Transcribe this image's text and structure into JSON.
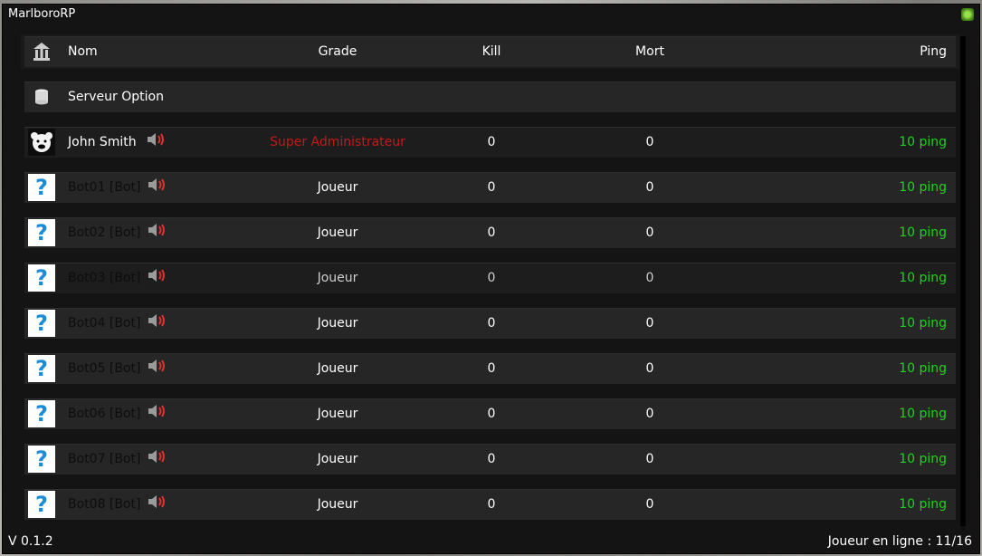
{
  "window": {
    "title": "MarlboroRP"
  },
  "header": {
    "name": "Nom",
    "grade": "Grade",
    "kill": "Kill",
    "mort": "Mort",
    "ping": "Ping"
  },
  "server_option": {
    "label": "Serveur Option"
  },
  "players": [
    {
      "name": "John Smith",
      "grade": "Super Administrateur",
      "kill": "0",
      "mort": "0",
      "ping": "10 ping",
      "avatar": "bear-avatar"
    },
    {
      "name": "Bot01 [Bot]",
      "grade": "Joueur",
      "kill": "0",
      "mort": "0",
      "ping": "10 ping",
      "avatar": "question-mark-icon"
    },
    {
      "name": "Bot02 [Bot]",
      "grade": "Joueur",
      "kill": "0",
      "mort": "0",
      "ping": "10 ping",
      "avatar": "question-mark-icon"
    },
    {
      "name": "Bot03 [Bot]",
      "grade": "Joueur",
      "kill": "0",
      "mort": "0",
      "ping": "10 ping",
      "avatar": "question-mark-icon"
    },
    {
      "name": "Bot04 [Bot]",
      "grade": "Joueur",
      "kill": "0",
      "mort": "0",
      "ping": "10 ping",
      "avatar": "question-mark-icon"
    },
    {
      "name": "Bot05 [Bot]",
      "grade": "Joueur",
      "kill": "0",
      "mort": "0",
      "ping": "10 ping",
      "avatar": "question-mark-icon"
    },
    {
      "name": "Bot06 [Bot]",
      "grade": "Joueur",
      "kill": "0",
      "mort": "0",
      "ping": "10 ping",
      "avatar": "question-mark-icon"
    },
    {
      "name": "Bot07 [Bot]",
      "grade": "Joueur",
      "kill": "0",
      "mort": "0",
      "ping": "10 ping",
      "avatar": "question-mark-icon"
    },
    {
      "name": "Bot08 [Bot]",
      "grade": "Joueur",
      "kill": "0",
      "mort": "0",
      "ping": "10 ping",
      "avatar": "question-mark-icon"
    }
  ],
  "footer": {
    "version": "V 0.1.2",
    "online": "Joueur en ligne : 11/16"
  },
  "colors": {
    "ping": "#1ed21e",
    "admin": "#c41a1a",
    "background": "#141414"
  }
}
